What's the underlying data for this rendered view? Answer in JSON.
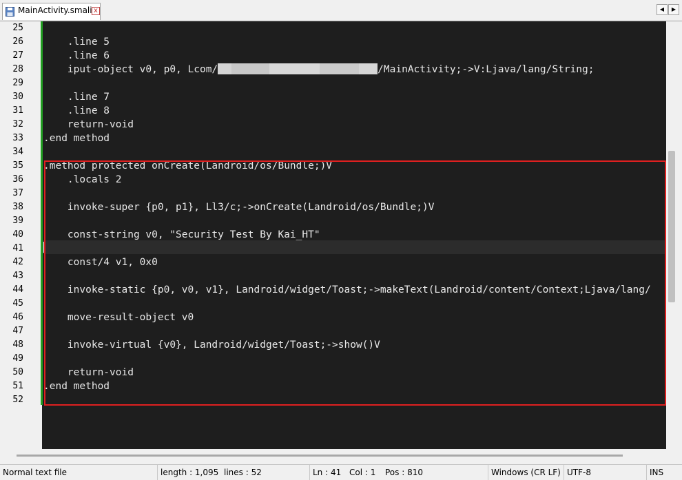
{
  "tabs": [
    {
      "label": "MainActivity.smali",
      "icon": "save-file-icon",
      "close": "x"
    }
  ],
  "nav": {
    "left": "◀",
    "right": "▶"
  },
  "editor": {
    "lines": [
      {
        "n": "25",
        "text": ""
      },
      {
        "n": "26",
        "text": "    .line 5"
      },
      {
        "n": "27",
        "text": "    .line 6"
      },
      {
        "n": "28",
        "pre": "    iput-object v0, p0, Lcom/",
        "post": "/MainActivity;->V:Ljava/lang/String;"
      },
      {
        "n": "29",
        "text": ""
      },
      {
        "n": "30",
        "text": "    .line 7"
      },
      {
        "n": "31",
        "text": "    .line 8"
      },
      {
        "n": "32",
        "text": "    return-void"
      },
      {
        "n": "33",
        "text": ".end method"
      },
      {
        "n": "34",
        "text": ""
      },
      {
        "n": "35",
        "text": ".method protected onCreate(Landroid/os/Bundle;)V"
      },
      {
        "n": "36",
        "text": "    .locals 2"
      },
      {
        "n": "37",
        "text": ""
      },
      {
        "n": "38",
        "text": "    invoke-super {p0, p1}, Ll3/c;->onCreate(Landroid/os/Bundle;)V"
      },
      {
        "n": "39",
        "text": ""
      },
      {
        "n": "40",
        "text": "    const-string v0, \"Security Test By Kai_HT\""
      },
      {
        "n": "41",
        "text": ""
      },
      {
        "n": "42",
        "text": "    const/4 v1, 0x0"
      },
      {
        "n": "43",
        "text": ""
      },
      {
        "n": "44",
        "text": "    invoke-static {p0, v0, v1}, Landroid/widget/Toast;->makeText(Landroid/content/Context;Ljava/lang/"
      },
      {
        "n": "45",
        "text": ""
      },
      {
        "n": "46",
        "text": "    move-result-object v0"
      },
      {
        "n": "47",
        "text": ""
      },
      {
        "n": "48",
        "text": "    invoke-virtual {v0}, Landroid/widget/Toast;->show()V"
      },
      {
        "n": "49",
        "text": ""
      },
      {
        "n": "50",
        "text": "    return-void"
      },
      {
        "n": "51",
        "text": ".end method"
      },
      {
        "n": "52",
        "text": ""
      }
    ]
  },
  "status": {
    "type": "Normal text file",
    "length": "length : 1,095",
    "lines": "lines : 52",
    "ln": "Ln : 41",
    "col": "Col : 1",
    "pos": "Pos : 810",
    "eol": "Windows (CR LF)",
    "encoding": "UTF-8",
    "mode": "INS"
  },
  "colors": {
    "editor_bg": "#1e1e1e",
    "highlight_box": "#e02020",
    "change_bar": "#23a023"
  }
}
